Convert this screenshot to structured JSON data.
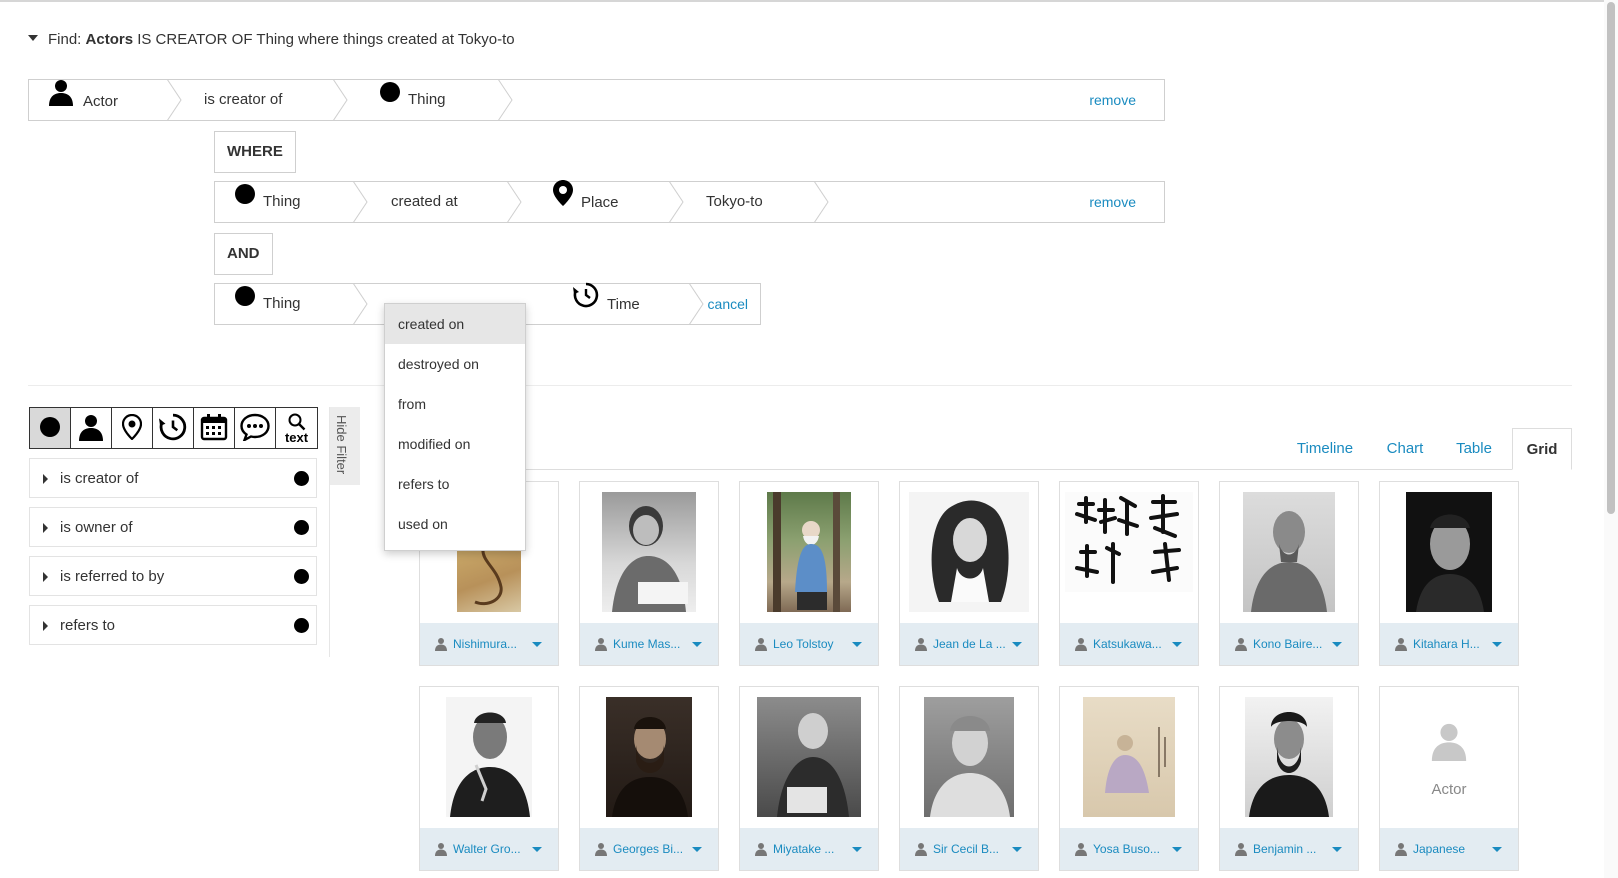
{
  "header": {
    "prefix": "Find:",
    "subject": "Actors",
    "rest": " IS CREATOR OF Thing where things created at Tokyo-to"
  },
  "query_rows": [
    {
      "segments": [
        {
          "icon": "person-icon",
          "label": "Actor"
        },
        {
          "label": "is creator of"
        },
        {
          "icon": "thing-dot-icon",
          "label": "Thing"
        }
      ],
      "action": "remove"
    },
    {
      "segments": [
        {
          "icon": "thing-dot-icon",
          "label": "Thing"
        },
        {
          "label": "created at"
        },
        {
          "icon": "map-pin-icon",
          "label": "Place"
        },
        {
          "label": "Tokyo-to"
        }
      ],
      "action": "remove"
    },
    {
      "segments": [
        {
          "icon": "thing-dot-icon",
          "label": "Thing"
        },
        {
          "icon": "clock-history-icon",
          "label": "Time"
        }
      ],
      "action": "cancel"
    }
  ],
  "operators": {
    "where": "WHERE",
    "and": "AND"
  },
  "relation_dropdown": {
    "items": [
      "created on",
      "destroyed on",
      "from",
      "modified on",
      "refers to",
      "used on"
    ],
    "selected": "created on"
  },
  "type_filter": {
    "buttons": [
      "thing-dot-icon",
      "person-icon",
      "map-pin-icon",
      "clock-history-icon",
      "calendar-icon",
      "speech-bubble-icon",
      "search-icon"
    ],
    "text_button_label": "text",
    "active": "thing-dot-icon"
  },
  "facets": [
    "is creator of",
    "is owner of",
    "is referred to by",
    "refers to"
  ],
  "hide_filter_label": "Hide Filter",
  "view_tabs": {
    "tabs": [
      "Timeline",
      "Chart",
      "Table",
      "Grid"
    ],
    "active": "Grid"
  },
  "grid": {
    "cards": [
      {
        "name": "Nishimura...",
        "image": "woodblock-print"
      },
      {
        "name": "Kume Mas...",
        "image": "bw-portrait"
      },
      {
        "name": "Leo Tolstoy",
        "image": "color-photo-garden"
      },
      {
        "name": "Jean de La ...",
        "image": "engraving-portrait"
      },
      {
        "name": "Katsukawa...",
        "image": "calligraphy"
      },
      {
        "name": "Kono Baire...",
        "image": "bw-portrait"
      },
      {
        "name": "Kitahara H...",
        "image": "bw-portrait-dark"
      },
      {
        "name": "Walter Gro...",
        "image": "bw-portrait"
      },
      {
        "name": "Georges Bi...",
        "image": "sepia-portrait"
      },
      {
        "name": "Miyatake ...",
        "image": "bw-photo"
      },
      {
        "name": "Sir Cecil B...",
        "image": "bw-portrait"
      },
      {
        "name": "Yosa Buso...",
        "image": "scroll-painting"
      },
      {
        "name": "Benjamin ...",
        "image": "bw-portrait"
      },
      {
        "name": "Japanese",
        "image": "placeholder",
        "placeholder_label": "Actor"
      }
    ]
  },
  "colors": {
    "link": "#1a8bc0",
    "card_footer": "#e3ecf2",
    "active_tab_text": "#333333"
  }
}
